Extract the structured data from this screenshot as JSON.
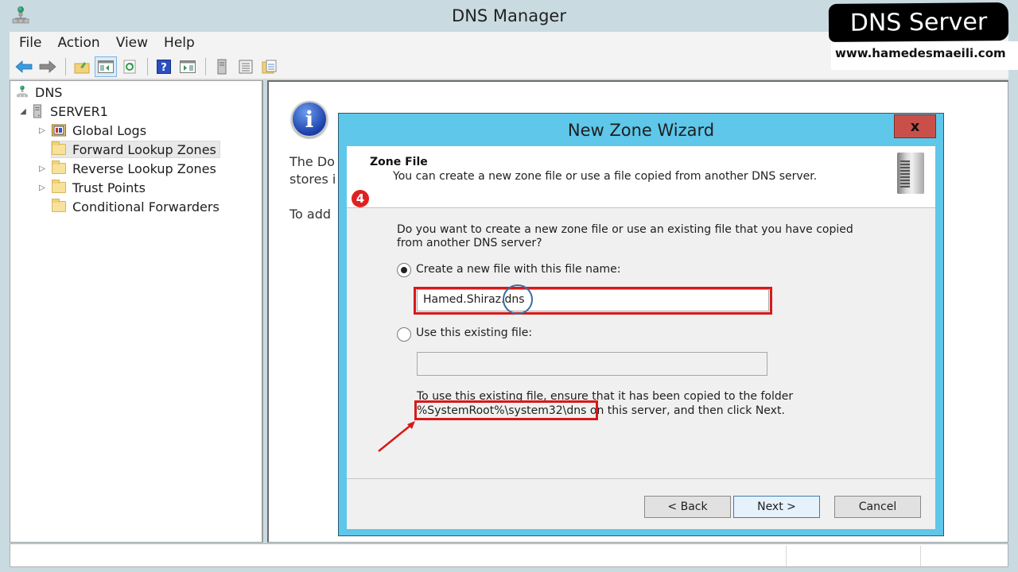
{
  "window": {
    "title": "DNS Manager",
    "menu": [
      "File",
      "Action",
      "View",
      "Help"
    ],
    "toolbar_icons": [
      "back-arrow-icon",
      "forward-arrow-icon",
      "up-folder-icon",
      "show-hide-console-tree-icon",
      "refresh-icon",
      "help-icon",
      "show-hide-action-pane-icon",
      "server-icon",
      "list-icon",
      "export-list-icon"
    ]
  },
  "tree": {
    "root": "DNS",
    "server": "SERVER1",
    "children": [
      {
        "label": "Global Logs",
        "expandable": true
      },
      {
        "label": "Forward Lookup Zones",
        "expandable": false,
        "selected": true
      },
      {
        "label": "Reverse Lookup Zones",
        "expandable": true
      },
      {
        "label": "Trust Points",
        "expandable": true
      },
      {
        "label": "Conditional Forwarders",
        "expandable": false
      }
    ]
  },
  "content": {
    "line1": "The Do",
    "line2": "stores i",
    "line3": "To add"
  },
  "wizard": {
    "title": "New Zone Wizard",
    "close_label": "x",
    "header_title": "Zone File",
    "header_subtitle": "You can create a new zone file or use a file copied from another DNS server.",
    "step_badge": "4",
    "question_line1": "Do you want to create a new zone file or use an existing file that you have copied",
    "question_line2": "from another DNS server?",
    "option_new_label": "Create a new file with this file name:",
    "option_new_selected": true,
    "new_file_value": "Hamed.Shiraz.dns",
    "option_existing_label": "Use this existing file:",
    "option_existing_selected": false,
    "existing_file_value": "",
    "note_line1": "To use this existing file, ensure that it has been copied to the folder",
    "note_path": "%SystemRoot%\\system32\\dns",
    "note_line2_rest": " on this server, and then click Next.",
    "buttons": {
      "back": "< Back",
      "next": "Next >",
      "cancel": "Cancel"
    }
  },
  "watermark": {
    "title": "DNS Server",
    "url": "www.hamedesmaeili.com"
  },
  "colors": {
    "wizard_frame": "#5ec7ea",
    "close_button": "#c9504a",
    "highlight": "#d91818",
    "circle": "#3b6fa0",
    "badge": "#e02020"
  }
}
